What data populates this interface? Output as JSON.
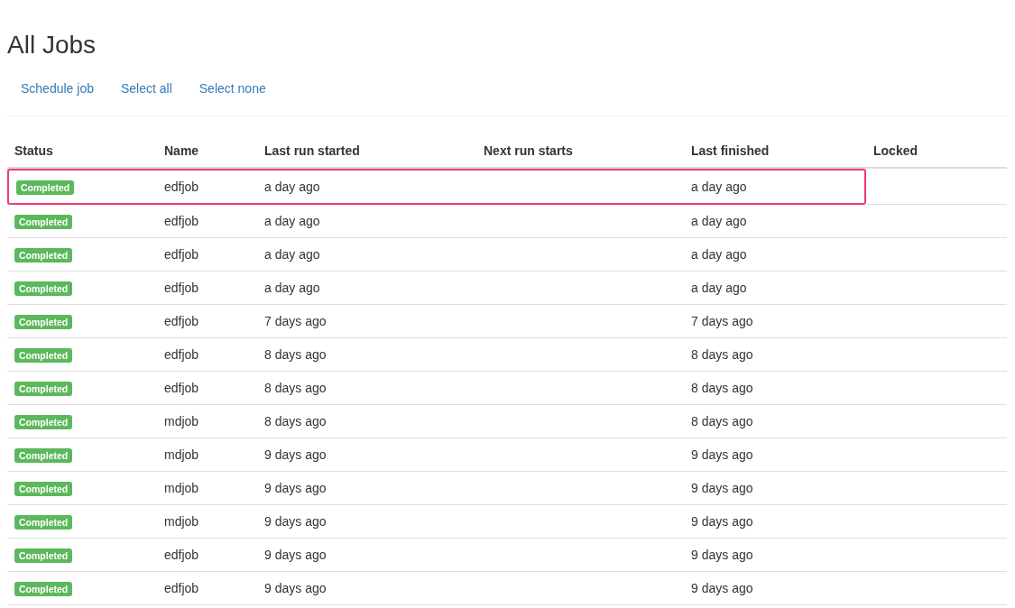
{
  "page_title": "All Jobs",
  "actions": [
    "Schedule job",
    "Select all",
    "Select none"
  ],
  "table": {
    "columns": [
      "Status",
      "Name",
      "Last run started",
      "Next run starts",
      "Last finished",
      "Locked"
    ],
    "rows": [
      {
        "status": "Completed",
        "name": "edfjob",
        "last_run_started": "a day ago",
        "last_finished": "a day ago",
        "highlighted": true
      },
      {
        "status": "Completed",
        "name": "edfjob",
        "last_run_started": "a day ago",
        "last_finished": "a day ago",
        "highlighted": false
      },
      {
        "status": "Completed",
        "name": "edfjob",
        "last_run_started": "a day ago",
        "last_finished": "a day ago",
        "highlighted": false
      },
      {
        "status": "Completed",
        "name": "edfjob",
        "last_run_started": "a day ago",
        "last_finished": "a day ago",
        "highlighted": false
      },
      {
        "status": "Completed",
        "name": "edfjob",
        "last_run_started": "7 days ago",
        "last_finished": "7 days ago",
        "highlighted": false
      },
      {
        "status": "Completed",
        "name": "edfjob",
        "last_run_started": "8 days ago",
        "last_finished": "8 days ago",
        "highlighted": false
      },
      {
        "status": "Completed",
        "name": "edfjob",
        "last_run_started": "8 days ago",
        "last_finished": "8 days ago",
        "highlighted": false
      },
      {
        "status": "Completed",
        "name": "mdjob",
        "last_run_started": "8 days ago",
        "last_finished": "8 days ago",
        "highlighted": false
      },
      {
        "status": "Completed",
        "name": "mdjob",
        "last_run_started": "9 days ago",
        "last_finished": "9 days ago",
        "highlighted": false
      },
      {
        "status": "Completed",
        "name": "mdjob",
        "last_run_started": "9 days ago",
        "last_finished": "9 days ago",
        "highlighted": false
      },
      {
        "status": "Completed",
        "name": "mdjob",
        "last_run_started": "9 days ago",
        "last_finished": "9 days ago",
        "highlighted": false
      },
      {
        "status": "Completed",
        "name": "edfjob",
        "last_run_started": "9 days ago",
        "last_finished": "9 days ago",
        "highlighted": false
      },
      {
        "status": "Completed",
        "name": "edfjob",
        "last_run_started": "9 days ago",
        "last_finished": "9 days ago",
        "highlighted": false
      }
    ]
  }
}
